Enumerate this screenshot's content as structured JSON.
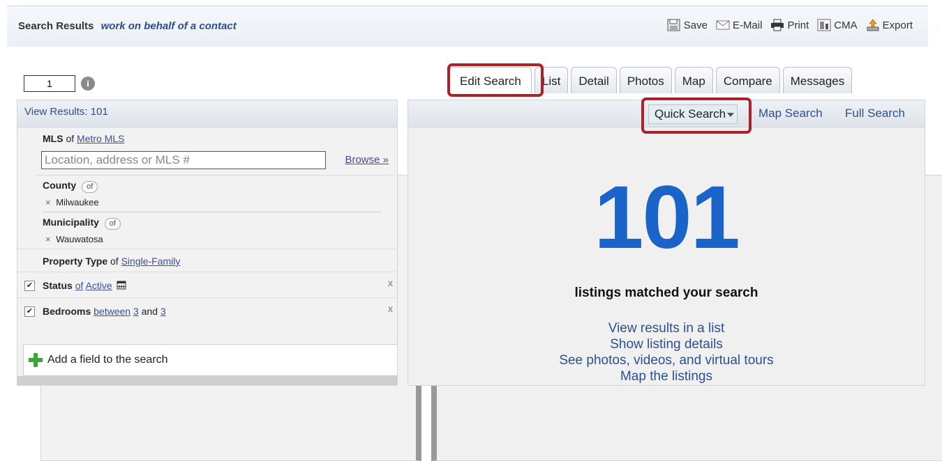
{
  "header": {
    "title": "Search Results",
    "subtitle": "work on behalf of a contact",
    "tools": [
      {
        "label": "Save",
        "icon": "save-icon"
      },
      {
        "label": "E-Mail",
        "icon": "email-icon"
      },
      {
        "label": "Print",
        "icon": "print-icon"
      },
      {
        "label": "CMA",
        "icon": "cma-icon"
      },
      {
        "label": "Export",
        "icon": "export-icon"
      }
    ]
  },
  "pager": {
    "page": "1"
  },
  "tabs": [
    "Edit Search",
    "List",
    "Detail",
    "Photos",
    "Map",
    "Compare",
    "Messages"
  ],
  "left": {
    "view_results": "View Results: 101",
    "mls_label": "MLS",
    "mls_of": "of",
    "mls_value": "Metro MLS",
    "search_placeholder": "Location, address or MLS #",
    "browse": "Browse »",
    "county_label": "County",
    "county_value": "Milwaukee",
    "municipality_label": "Municipality",
    "municipality_value": "Wauwatosa",
    "of_pill": "of",
    "remove_x": "×",
    "property_type_label": "Property Type",
    "property_type_of": "of",
    "property_type_value": "Single-Family",
    "status_label": "Status",
    "status_of": "of",
    "status_value": "Active",
    "bedrooms_label": "Bedrooms",
    "bedrooms_between": "between",
    "bedrooms_min": "3",
    "bedrooms_and": "and",
    "bedrooms_max": "3",
    "remove_criteria": "x",
    "add_field": "Add a field to the search"
  },
  "right": {
    "quick_search": "Quick Search",
    "map_search": "Map Search",
    "full_search": "Full Search",
    "count": "101",
    "matched": "listings matched your search",
    "links": [
      "View results in a list",
      "Show listing details",
      "See photos, videos, and virtual tours",
      "Map the listings"
    ]
  },
  "colors": {
    "highlight": "#b0202a",
    "accent_blue": "#1a63c8",
    "link": "#2d4f8f"
  }
}
